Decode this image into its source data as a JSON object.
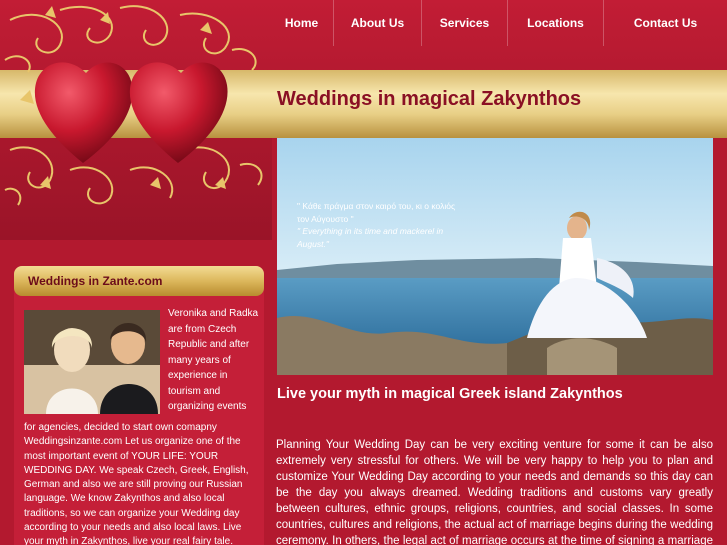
{
  "nav": {
    "items": [
      {
        "label": "Home"
      },
      {
        "label": "About Us"
      },
      {
        "label": "Services"
      },
      {
        "label": "Locations"
      },
      {
        "label": "Contact Us"
      }
    ]
  },
  "header": {
    "title": "Weddings in magical Zakynthos"
  },
  "sidebar": {
    "title": "Weddings in Zante.com",
    "text_right": "Veronika and Radka are from Czech Republic and after many years of experience in tourism and organizing events",
    "text_bottom": "for agencies, decided to start own comapny Weddingsinzante.com Let us organize one of the most important event of YOUR LIFE: YOUR WEDDING DAY. We speak Czech, Greek, English, German and also we are still proving our Russian language. We know Zakynthos and also local traditions, so we can organize your Wedding day according to your needs and also local laws. Live your myth in Zakynthos, live your real fairy tale."
  },
  "hero": {
    "quote_greek": "\" Κάθε πράγμα στον καιρό του, κι ο κολιός τον Αύγουστο \"",
    "quote_english": "\" Everything in its time and mackerel in August.\""
  },
  "main": {
    "heading": "Live your myth in magical Greek island Zakynthos",
    "paragraph": "Planning Your Wedding Day can be very exciting venture for some it can be also extremely very stressful for others. We will be very happy to help you to plan and customize Your Wedding Day according to your needs and demands so this day can be the day you always dreamed. Wedding traditions and customs vary greatly between cultures, ethnic groups, religions, countries, and social classes. In some countries, cultures and religions, the actual act of marriage begins during the wedding ceremony. In others, the legal act of marriage occurs at the time of signing a marriage license or other"
  },
  "colors": {
    "background": "#b11a2f",
    "gold": "#e8cf86",
    "title": "#8a1024"
  },
  "icons": {
    "hearts": "two-hearts-icon",
    "ornament": "gold-swirl-ornament"
  }
}
